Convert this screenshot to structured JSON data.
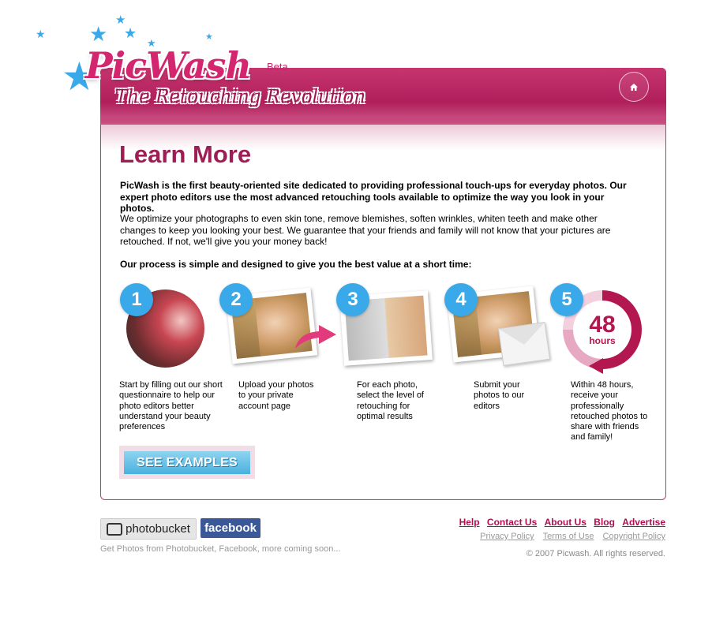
{
  "brand": {
    "name": "PicWash",
    "beta": "Beta",
    "tagline": "The Retouching Revolution",
    "accent": "#b01f5b",
    "step_color": "#3aa9ea"
  },
  "header": {
    "home_icon": "home-icon"
  },
  "main": {
    "title": "Learn More",
    "intro_bold": "PicWash is the first beauty-oriented site dedicated to providing professional touch-ups for everyday photos. Our expert photo editors use the most advanced retouching tools available to optimize the way you look in your photos.",
    "intro": "We optimize your photographs to even skin tone, remove blemishes, soften wrinkles, whiten teeth and make other changes to keep you looking your best. We guarantee that your friends and family will not know that your pictures are retouched. If not, we'll give you your money back!",
    "process_heading": "Our process is simple and designed to give you the best value at a short time:",
    "steps": [
      {
        "number": "1",
        "text": "Start by filling out our short questionnaire to help our photo editors better understand your beauty preferences"
      },
      {
        "number": "2",
        "text": "Upload your photos to your private account page"
      },
      {
        "number": "3",
        "text": "For each photo, select the level of retouching for optimal results"
      },
      {
        "number": "4",
        "text": "Submit your photos to our editors"
      },
      {
        "number": "5",
        "text": "Within 48 hours, receive your professionally retouched photos to share with friends and family!"
      }
    ],
    "clock_number": "48",
    "clock_unit": "hours",
    "examples_button": "SEE EXAMPLES"
  },
  "footer": {
    "photobucket": "photobucket",
    "facebook": "facebook",
    "coming_soon": "Get Photos from Photobucket, Facebook, more coming soon...",
    "links": [
      "Help",
      "Contact Us",
      "About Us",
      "Blog",
      "Advertise"
    ],
    "policies": [
      "Privacy Policy",
      "Terms of Use",
      "Copyright Policy"
    ],
    "copyright": "© 2007 Picwash. All rights reserved."
  }
}
